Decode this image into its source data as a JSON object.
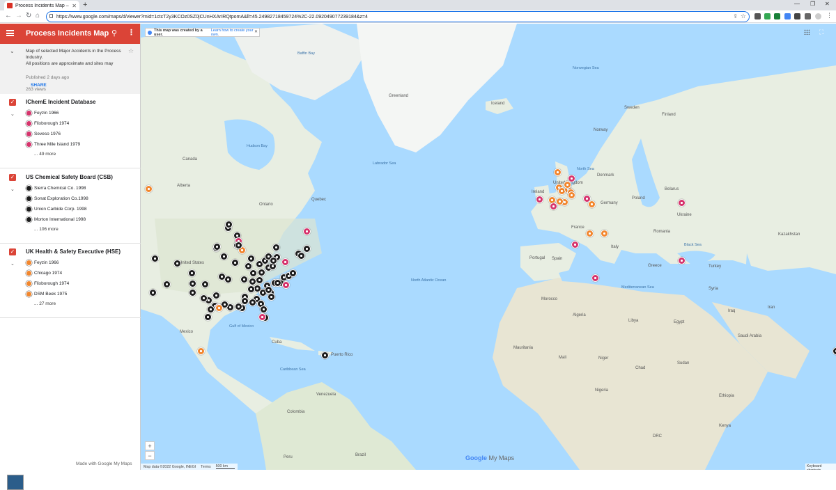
{
  "browser": {
    "tab_title": "Process Incidents Map – Google",
    "url": "https://www.google.com/maps/d/viewer?mid=1ctcT2y3KCOz0SZ0jCUnHXArIRQtpomA&ll=45.24982718459724%2C-22.092049077239184&z=4"
  },
  "panel": {
    "title": "Process Incidents Map",
    "description": "Map of selected Major Accidents in the Process Industry.",
    "description2": "All positions are approximate and sites may",
    "views": "263 views",
    "published": "Published 2 days ago",
    "share": "SHARE",
    "made_with": "Made with Google My Maps",
    "layers": [
      {
        "name": "IChemE Incident Database",
        "more": "... 49 more",
        "items": [
          {
            "label": "Feyzin 1966",
            "color": "#d6336c"
          },
          {
            "label": "Flixborough 1974",
            "color": "#d6336c"
          },
          {
            "label": "Seveso 1976",
            "color": "#d6336c"
          },
          {
            "label": "Three Mile Island 1979",
            "color": "#d6336c"
          }
        ]
      },
      {
        "name": "US Chemical Safety Board (CSB)",
        "more": "... 106 more",
        "items": [
          {
            "label": "Sierra Chemical Co. 1998",
            "color": "#1c1c1c"
          },
          {
            "label": "Sonat Exploration Co.1998",
            "color": "#1c1c1c"
          },
          {
            "label": "Union Carbide Corp. 1998",
            "color": "#1c1c1c"
          },
          {
            "label": "Morton International 1998",
            "color": "#1c1c1c"
          }
        ]
      },
      {
        "name": "UK Health & Safety Executive (HSE)",
        "more": "... 27 more",
        "items": [
          {
            "label": "Feyzin 1966",
            "color": "#f2862d"
          },
          {
            "label": "Chicago 1974",
            "color": "#f2862d"
          },
          {
            "label": "Flixborough 1974",
            "color": "#f2862d"
          },
          {
            "label": "DSM Beek 1975",
            "color": "#f2862d"
          }
        ]
      }
    ]
  },
  "map": {
    "notice": "This map was created by a user.",
    "notice_link": "Learn how to create your own.",
    "attribution": "Map data ©2022 Google, INEGI",
    "terms": "Terms",
    "scale": "500 km",
    "logo_google": "Google",
    "logo_mymaps": "My Maps",
    "keyboard": "Keyboard shortcuts",
    "labels": {
      "greenland": "Greenland",
      "canada": "Canada",
      "us": "United States",
      "mexico": "Mexico",
      "cuba": "Cuba",
      "venezuela": "Venezuela",
      "colombia": "Colombia",
      "brazil": "Brazil",
      "peru": "Peru",
      "ireland": "Ireland",
      "uk": "United Kingdom",
      "france": "France",
      "spain": "Spain",
      "portugal": "Portugal",
      "germany": "Germany",
      "poland": "Poland",
      "norway": "Norway",
      "sweden": "Sweden",
      "finland": "Finland",
      "italy": "Italy",
      "ukraine": "Ukraine",
      "turkey": "Turkey",
      "algeria": "Algeria",
      "libya": "Libya",
      "egypt": "Egypt",
      "mali": "Mali",
      "niger": "Niger",
      "chad": "Chad",
      "sudan": "Sudan",
      "nigeria": "Nigeria",
      "morocco": "Morocco",
      "iceland": "Iceland",
      "denmark": "Denmark",
      "belarus": "Belarus",
      "iraq": "Iraq",
      "saudi": "Saudi Arabia",
      "kazakhstan": "Kazakhstan",
      "ethiopia": "Ethiopia",
      "drc": "DRC",
      "kenya": "Kenya",
      "mauritania": "Mauritania",
      "syria": "Syria",
      "iran": "Iran",
      "greece": "Greece",
      "romania": "Romania",
      "hudson": "Hudson Bay",
      "labrador": "Labrador Sea",
      "naocean": "North Atlantic Ocean",
      "gulf": "Gulf of Mexico",
      "caribbean": "Caribbean Sea",
      "north_sea": "North Sea",
      "norwegian": "Norwegian Sea",
      "med": "Mediterranean Sea",
      "black": "Black Sea",
      "baffin": "Baffin Bay",
      "puerto": "Puerto Rico",
      "quebec": "Quebec",
      "ontario": "Ontario",
      "alberta": "Alberta"
    }
  }
}
